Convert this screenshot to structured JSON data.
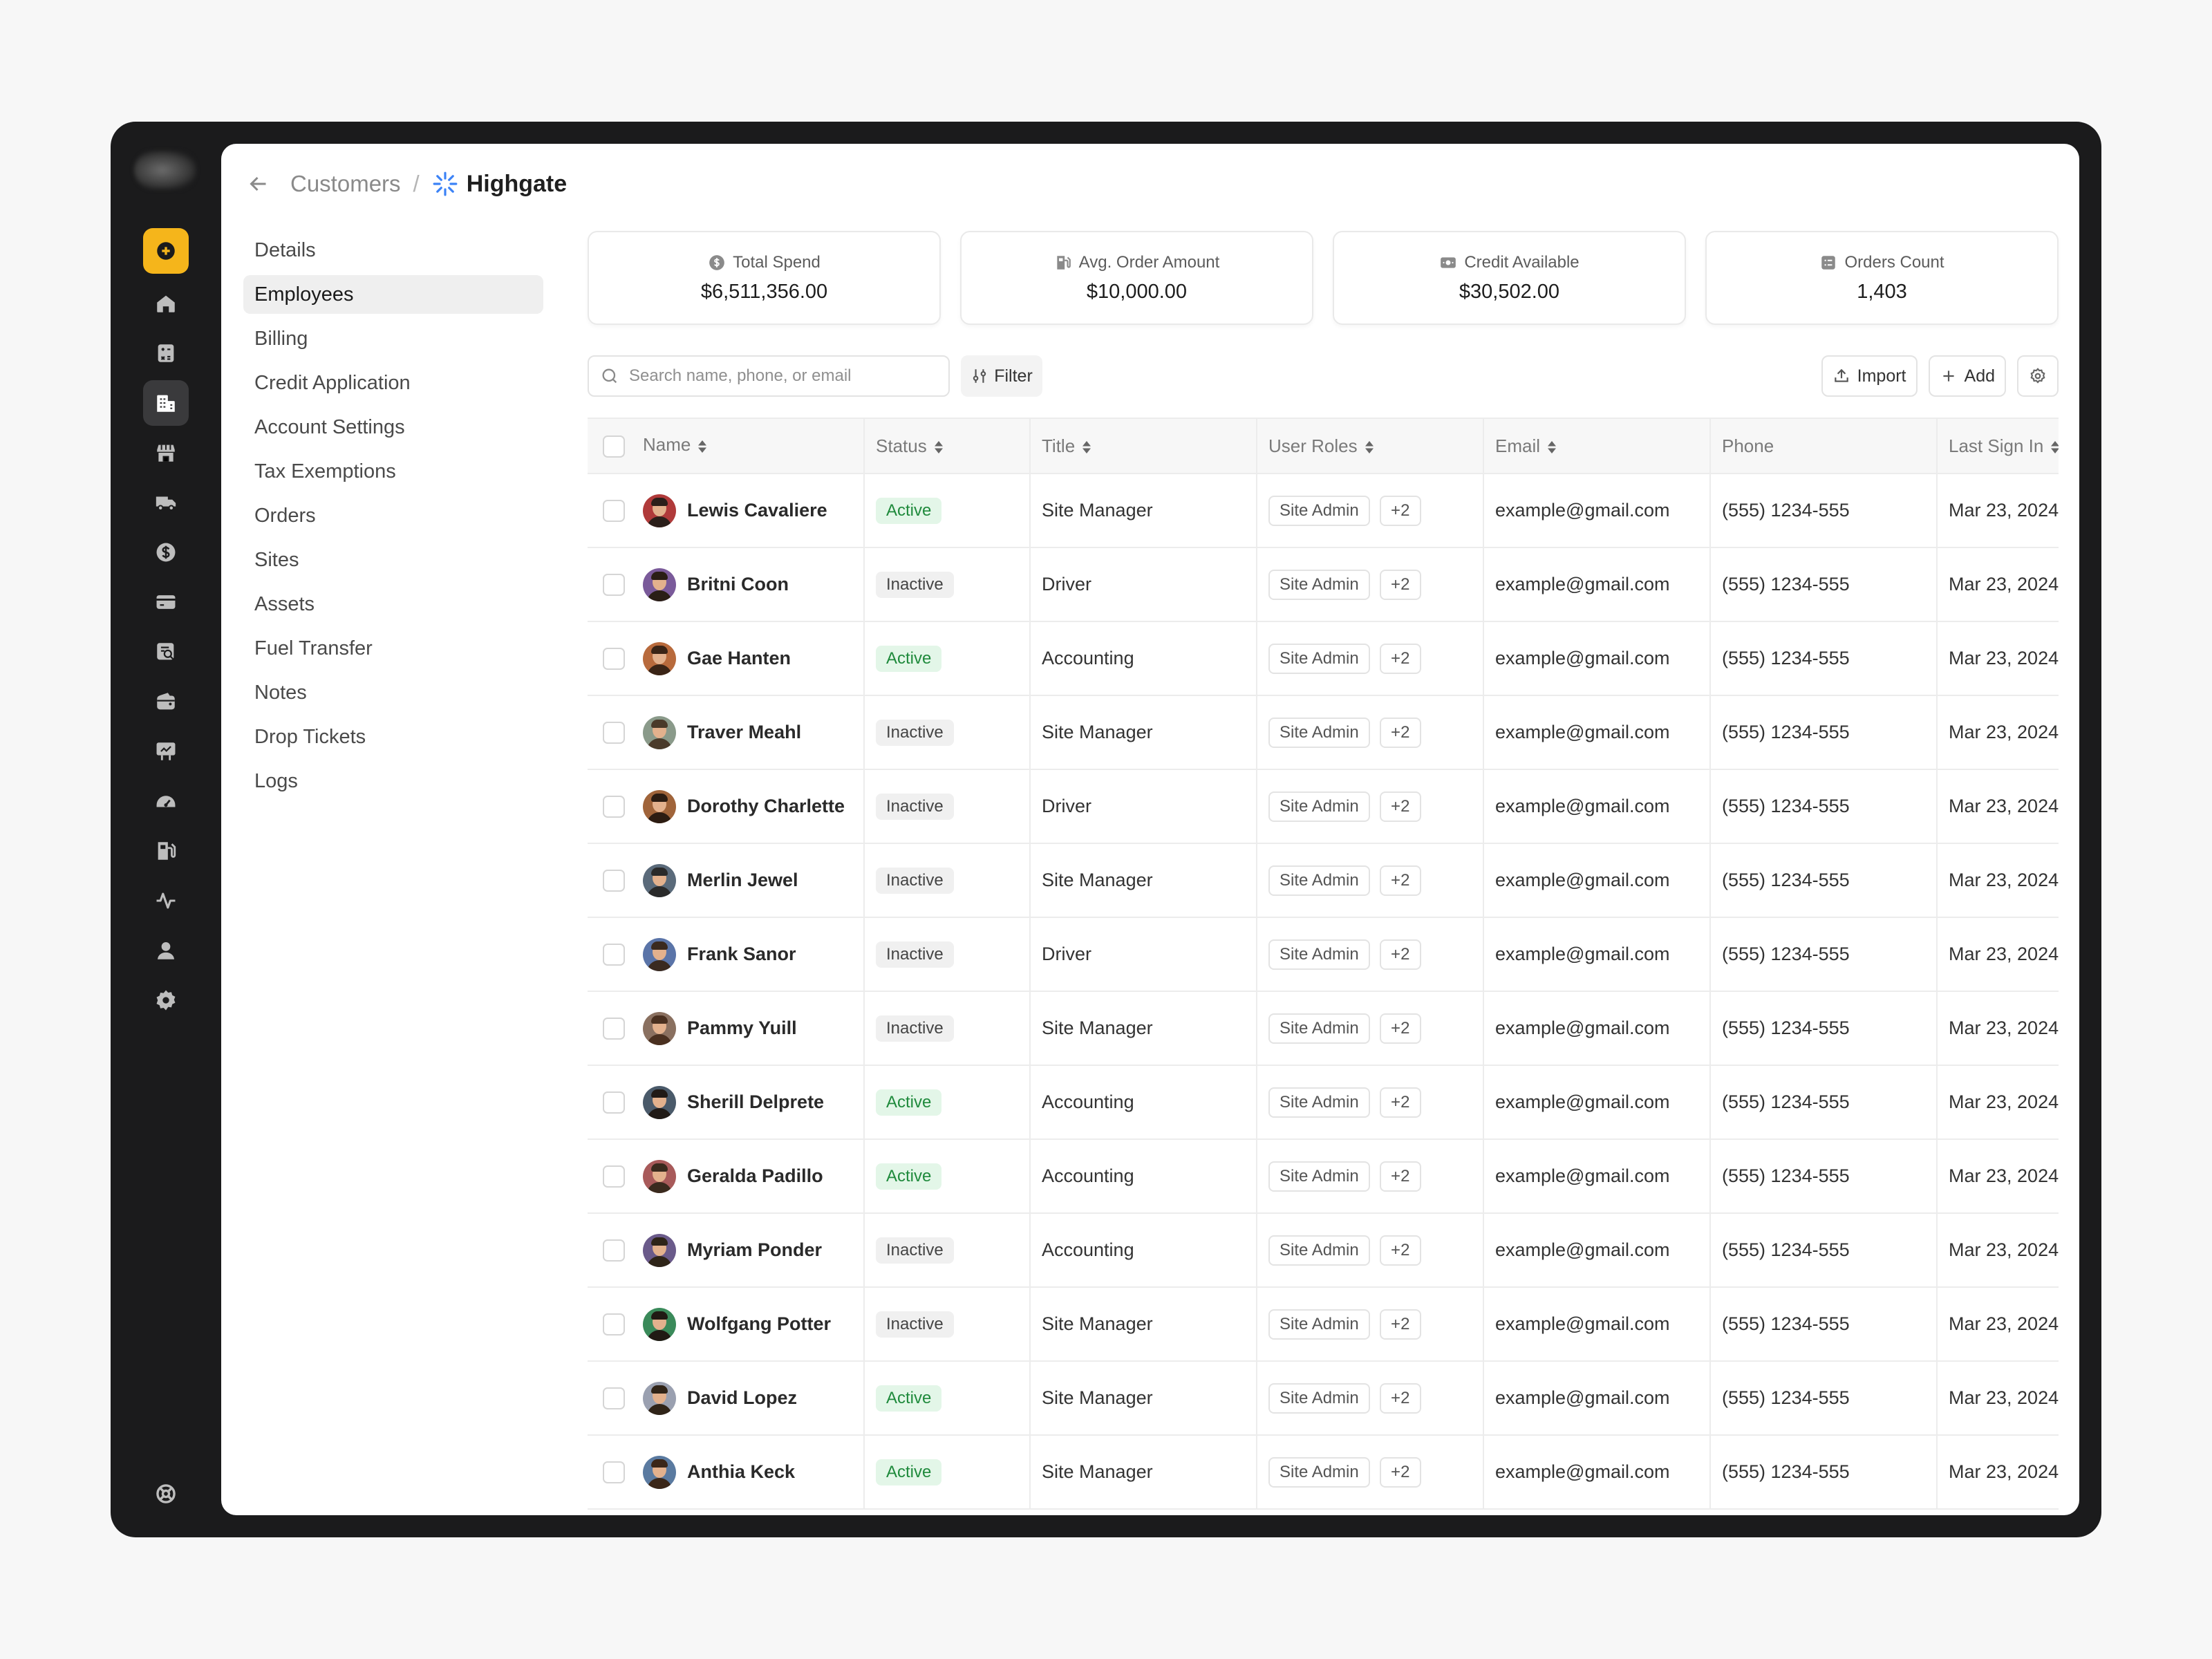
{
  "breadcrumb": {
    "parent": "Customers",
    "separator": "/",
    "current": "Highgate"
  },
  "colors": {
    "accent": "#f5b51b",
    "active_badge_bg": "#e3f6e8",
    "active_badge_text": "#1f8a3c",
    "rail_bg": "#1b1b1c",
    "customer_icon": "#3b82f6"
  },
  "rail": {
    "items": [
      {
        "icon": "plus-circle-icon",
        "state": "new"
      },
      {
        "icon": "home-icon"
      },
      {
        "icon": "calculator-icon"
      },
      {
        "icon": "building-icon",
        "state": "active"
      },
      {
        "icon": "store-icon"
      },
      {
        "icon": "truck-icon"
      },
      {
        "icon": "dollar-icon"
      },
      {
        "icon": "credit-card-icon"
      },
      {
        "icon": "report-search-icon"
      },
      {
        "icon": "wallet-icon"
      },
      {
        "icon": "billboard-icon"
      },
      {
        "icon": "gauge-icon"
      },
      {
        "icon": "fuel-pump-icon"
      },
      {
        "icon": "activity-icon"
      },
      {
        "icon": "user-icon"
      },
      {
        "icon": "gear-icon"
      }
    ],
    "footer_icon": "lifebuoy-icon"
  },
  "subnav": [
    {
      "label": "Details"
    },
    {
      "label": "Employees",
      "selected": true
    },
    {
      "label": "Billing"
    },
    {
      "label": "Credit Application"
    },
    {
      "label": "Account Settings"
    },
    {
      "label": "Tax Exemptions"
    },
    {
      "label": "Orders"
    },
    {
      "label": "Sites"
    },
    {
      "label": "Assets"
    },
    {
      "label": "Fuel Transfer"
    },
    {
      "label": "Notes"
    },
    {
      "label": "Drop Tickets"
    },
    {
      "label": "Logs"
    }
  ],
  "stats": [
    {
      "label": "Total Spend",
      "value": "$6,511,356.00",
      "icon": "dollar-circle-icon"
    },
    {
      "label": "Avg. Order Amount",
      "value": "$10,000.00",
      "icon": "fuel-pump-icon"
    },
    {
      "label": "Credit Available",
      "value": "$30,502.00",
      "icon": "cash-icon"
    },
    {
      "label": "Orders Count",
      "value": "1,403",
      "icon": "list-box-icon"
    }
  ],
  "toolbar": {
    "search_placeholder": "Search name, phone, or email",
    "filter_label": "Filter",
    "import_label": "Import",
    "add_label": "Add"
  },
  "table": {
    "columns": [
      "Name",
      "Status",
      "Title",
      "User Roles",
      "Email",
      "Phone",
      "Last Sign In"
    ],
    "rows": [
      {
        "name": "Lewis Cavaliere",
        "status": "Active",
        "title": "Site Manager",
        "role": "Site Admin",
        "more": "+2",
        "email": "example@gmail.com",
        "phone": "(555) 1234-555",
        "last_sign_in": "Mar 23, 2024"
      },
      {
        "name": "Britni Coon",
        "status": "Inactive",
        "title": "Driver",
        "role": "Site Admin",
        "more": "+2",
        "email": "example@gmail.com",
        "phone": "(555) 1234-555",
        "last_sign_in": "Mar 23, 2024"
      },
      {
        "name": "Gae Hanten",
        "status": "Active",
        "title": "Accounting",
        "role": "Site Admin",
        "more": "+2",
        "email": "example@gmail.com",
        "phone": "(555) 1234-555",
        "last_sign_in": "Mar 23, 2024"
      },
      {
        "name": "Traver Meahl",
        "status": "Inactive",
        "title": "Site Manager",
        "role": "Site Admin",
        "more": "+2",
        "email": "example@gmail.com",
        "phone": "(555) 1234-555",
        "last_sign_in": "Mar 23, 2024"
      },
      {
        "name": "Dorothy Charlette",
        "status": "Inactive",
        "title": "Driver",
        "role": "Site Admin",
        "more": "+2",
        "email": "example@gmail.com",
        "phone": "(555) 1234-555",
        "last_sign_in": "Mar 23, 2024"
      },
      {
        "name": "Merlin Jewel",
        "status": "Inactive",
        "title": "Site Manager",
        "role": "Site Admin",
        "more": "+2",
        "email": "example@gmail.com",
        "phone": "(555) 1234-555",
        "last_sign_in": "Mar 23, 2024"
      },
      {
        "name": "Frank Sanor",
        "status": "Inactive",
        "title": "Driver",
        "role": "Site Admin",
        "more": "+2",
        "email": "example@gmail.com",
        "phone": "(555) 1234-555",
        "last_sign_in": "Mar 23, 2024"
      },
      {
        "name": "Pammy Yuill",
        "status": "Inactive",
        "title": "Site Manager",
        "role": "Site Admin",
        "more": "+2",
        "email": "example@gmail.com",
        "phone": "(555) 1234-555",
        "last_sign_in": "Mar 23, 2024"
      },
      {
        "name": "Sherill Delprete",
        "status": "Active",
        "title": "Accounting",
        "role": "Site Admin",
        "more": "+2",
        "email": "example@gmail.com",
        "phone": "(555) 1234-555",
        "last_sign_in": "Mar 23, 2024"
      },
      {
        "name": "Geralda Padillo",
        "status": "Active",
        "title": "Accounting",
        "role": "Site Admin",
        "more": "+2",
        "email": "example@gmail.com",
        "phone": "(555) 1234-555",
        "last_sign_in": "Mar 23, 2024"
      },
      {
        "name": "Myriam Ponder",
        "status": "Inactive",
        "title": "Accounting",
        "role": "Site Admin",
        "more": "+2",
        "email": "example@gmail.com",
        "phone": "(555) 1234-555",
        "last_sign_in": "Mar 23, 2024"
      },
      {
        "name": "Wolfgang Potter",
        "status": "Inactive",
        "title": "Site Manager",
        "role": "Site Admin",
        "more": "+2",
        "email": "example@gmail.com",
        "phone": "(555) 1234-555",
        "last_sign_in": "Mar 23, 2024"
      },
      {
        "name": "David Lopez",
        "status": "Active",
        "title": "Site Manager",
        "role": "Site Admin",
        "more": "+2",
        "email": "example@gmail.com",
        "phone": "(555) 1234-555",
        "last_sign_in": "Mar 23, 2024"
      },
      {
        "name": "Anthia Keck",
        "status": "Active",
        "title": "Site Manager",
        "role": "Site Admin",
        "more": "+2",
        "email": "example@gmail.com",
        "phone": "(555) 1234-555",
        "last_sign_in": "Mar 23, 2024"
      }
    ]
  }
}
